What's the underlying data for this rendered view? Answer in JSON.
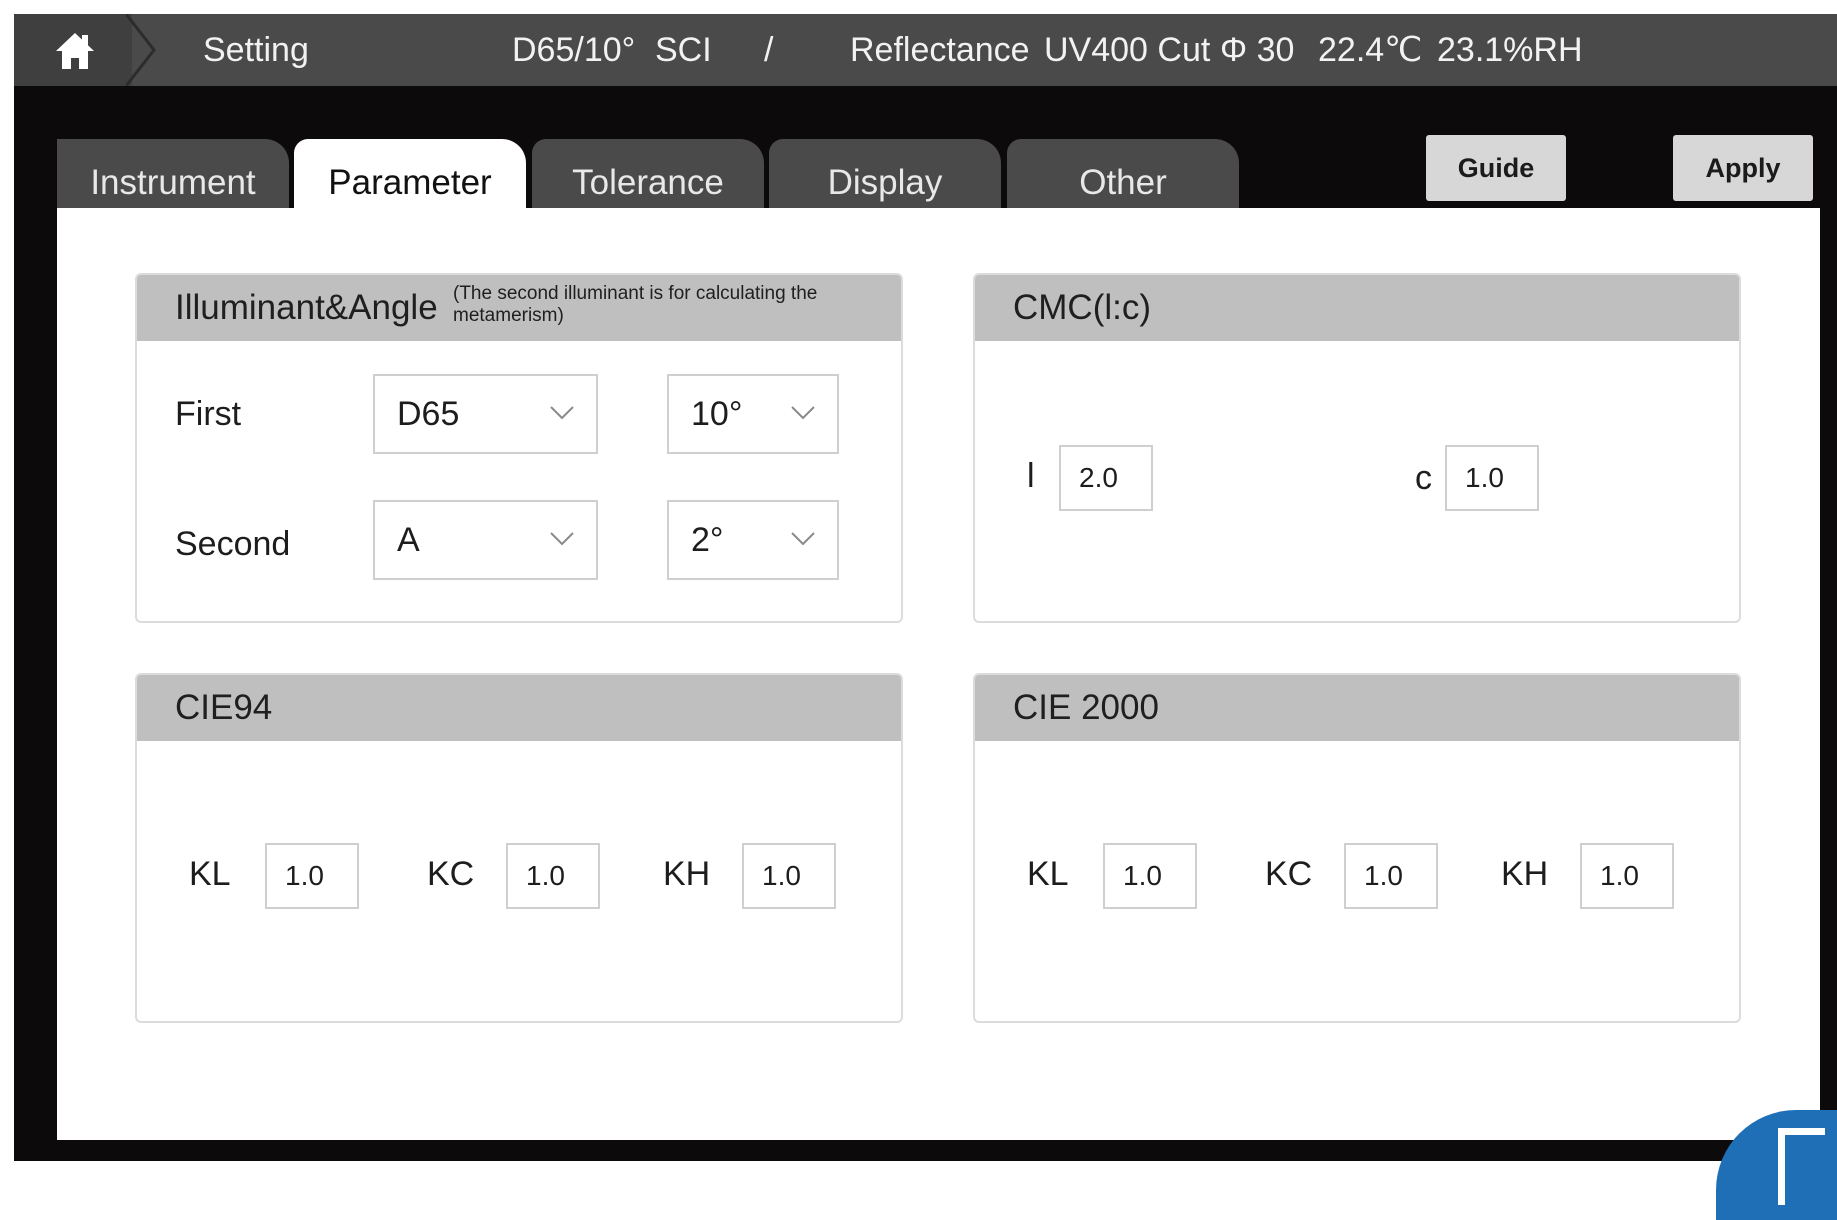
{
  "statusbar": {
    "title": "Setting",
    "illuminant": "D65/10°",
    "mode": "SCI",
    "separator": "/",
    "measure": "Reflectance",
    "uv": "UV400 Cut",
    "aperture": "Φ 30",
    "temperature": "22.4℃",
    "humidity": "23.1%RH"
  },
  "tabs": [
    {
      "label": "Instrument",
      "active": false
    },
    {
      "label": "Parameter",
      "active": true
    },
    {
      "label": "Tolerance",
      "active": false
    },
    {
      "label": "Display",
      "active": false
    },
    {
      "label": "Other",
      "active": false
    }
  ],
  "buttons": {
    "guide": "Guide",
    "apply": "Apply"
  },
  "illuminant_panel": {
    "title": "Illuminant&Angle",
    "note": "(The second illuminant is for calculating the metamerism)",
    "first": {
      "label": "First",
      "illuminant": "D65",
      "angle": "10°"
    },
    "second": {
      "label": "Second",
      "illuminant": "A",
      "angle": "2°"
    }
  },
  "cmc_panel": {
    "title": "CMC(l:c)",
    "l_label": "l",
    "l_value": "2.0",
    "c_label": "c",
    "c_value": "1.0"
  },
  "cie94_panel": {
    "title": "CIE94",
    "kl_label": "KL",
    "kl_value": "1.0",
    "kc_label": "KC",
    "kc_value": "1.0",
    "kh_label": "KH",
    "kh_value": "1.0"
  },
  "cie2000_panel": {
    "title": "CIE 2000",
    "kl_label": "KL",
    "kl_value": "1.0",
    "kc_label": "KC",
    "kc_value": "1.0",
    "kh_label": "KH",
    "kh_value": "1.0"
  },
  "colors": {
    "statusbar_bg": "#4a4a4a",
    "screen_bg": "#0d0a0b",
    "panel_header_bg": "#bfbfbf",
    "button_bg": "#d7d7d7"
  }
}
